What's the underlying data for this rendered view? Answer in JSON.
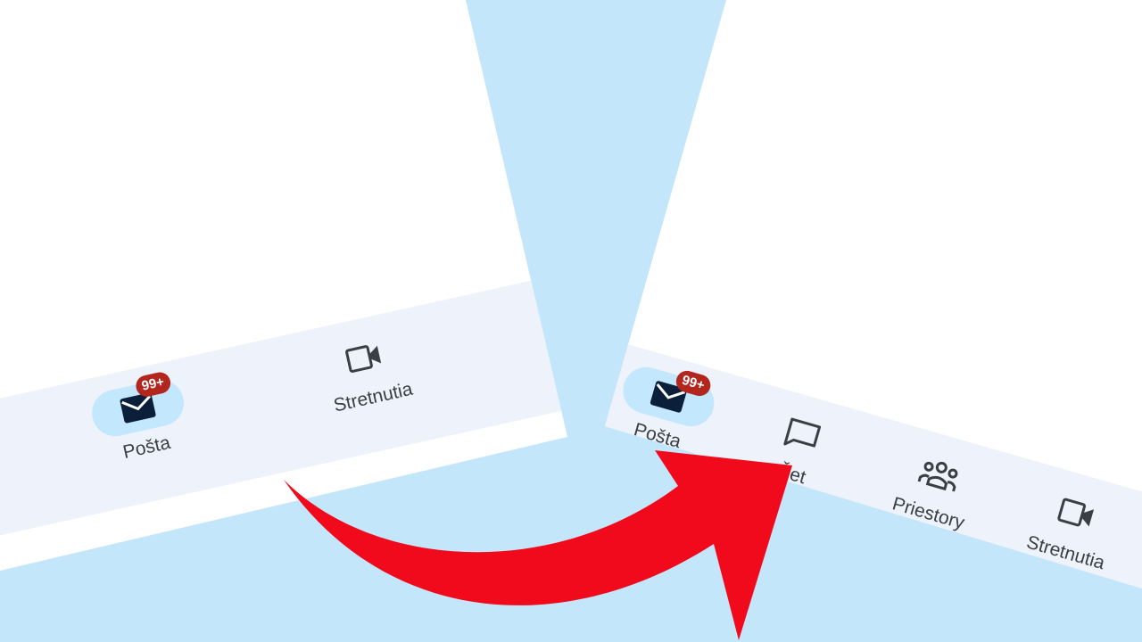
{
  "left_nav": {
    "items": [
      {
        "label": "Pošta",
        "icon": "mail-icon",
        "badge": "99+",
        "active": true
      },
      {
        "label": "Stretnutia",
        "icon": "video-icon"
      }
    ]
  },
  "right_nav": {
    "items": [
      {
        "label": "Pošta",
        "icon": "mail-icon",
        "badge": "99+",
        "active": true
      },
      {
        "label": "Čet",
        "icon": "chat-icon"
      },
      {
        "label": "Priestory",
        "icon": "people-icon"
      },
      {
        "label": "Stretnutia",
        "icon": "video-icon"
      }
    ]
  },
  "colors": {
    "background": "#c4e6fb",
    "navbar": "#eef2fa",
    "active_pill": "#c3e7fd",
    "badge": "#b3261e",
    "arrow": "#f00a1c",
    "icon": "#3b3f45",
    "mail_icon": "#0b1f3b"
  }
}
